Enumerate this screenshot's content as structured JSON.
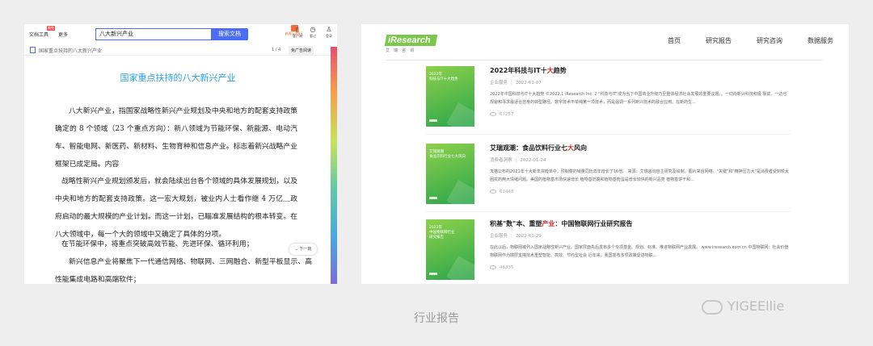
{
  "left": {
    "toolbar": {
      "doc_tools": "文档工具",
      "more": "更多",
      "badge": "限免",
      "search_value": "八大新兴产业",
      "search_button": "搜索文档",
      "gift_label": "新客立减8元",
      "icons": [
        {
          "name": "client-icon",
          "label": "客户端",
          "glyph": "▯"
        },
        {
          "name": "history-icon",
          "label": "看过",
          "glyph": "◷"
        },
        {
          "name": "user-icon",
          "label": "登录",
          "glyph": "♙"
        }
      ]
    },
    "docbar": {
      "title": "国家重点扶持的八大新兴产业",
      "page": "1 / 4",
      "read_button": "免广告阅读"
    },
    "document": {
      "title": "国家重点扶持的八大新兴产业",
      "p1": "八大新兴产业，指国家战略性新兴产业规划及中央和地方的配套支持政策确定的 8 个领域（23 个重点方向）：新八领域为节能环保、新能源、电动汽车、智能电网、新医药、新材料、生物育种和信息产业。标志着新兴战略产业框架已成定局。内容",
      "p2": "战略性新兴产业规划颁发后，就会陆续出台各个领域的具体发展规划，以及中央和地方的配套支持政策。这一宏大规划，被业内人士看作继 4 万亿＿政府启动的最大规模的产业计划。而这一计划，已瞄准发展结构的根本转变。在八大领域中，每一个大的领域中又确定了具体的分项。",
      "p3": "在节能环保中，将重点突破高效节能、先进环保、循环利用；",
      "p4": "新兴信息产业将聚焦下一代通信网络、物联网、三网融合、新型平板显示、高性能集成电路和高端软件；",
      "next_page": "下一篇"
    }
  },
  "right": {
    "logo": {
      "text": "iResearch",
      "sub": "艾瑞咨询"
    },
    "nav": [
      "首页",
      "研究报告",
      "研究咨询",
      "数据服务"
    ],
    "articles": [
      {
        "cover_text": "2022年\n科技与IT十大趋势",
        "title_pre": "2022年科技与IT十",
        "title_hl": "大",
        "title_post": "趋势",
        "category": "企业服务",
        "date": "2022-01-07",
        "summary": "2022年中国科技与IT十大趋势 ©2022.1 iResearch Inc. 2 \"科技与IT\"成为当下中国商业升级乃至整体经济社会发展的重要议题。。一切向新兴科技积极 靠拢、一边也规避和寻求最适合自身的转型路径。数字技术不单纯某一项技术，而是强调一系列新兴技术的融合应用。在新的生...",
        "views": "67257"
      },
      {
        "cover_text": "艾瑞观潮\n食品饮料行业七大风向",
        "title_pre": "艾瑞观潮：食品饮料行业七",
        "title_hl": "大",
        "title_post": "风向",
        "category": "消费者洞察",
        "date": "2022-01-24",
        "summary": "天猫公布的2021年十大新年货榜单中，预制菜的销量同比去年增长了16倍。 来源：艾瑞咨询自主研究及绘制。图片来自网络。\"关键\"和\"精神压力大\"是消费者受到较大困扰的两大情绪问题。美国的植物基市场快速增长 植物基奶酪和植物基肉蛋是增长较快的新兴品类 植物基饼干和...",
        "views": "61448"
      },
      {
        "cover_text": "2022年\n中国物联网行业\n研究报告",
        "title_pre": "积基\"数\"本、重塑",
        "title_hl": "产业",
        "title_post": "：中国物联网行业研究报告",
        "category": "企业服务",
        "date": "2022-01-29",
        "summary": "在此以后，物联网被列入国家战略性新兴产业。国家层面先后发布多个专项基金、规划、标准、推进物联网产业发展。 www.iresearch.com.cn 中国物联网：社会价值 物联网作为底层支撑技术重塑智能、高效、节约型社会 近年来，我国发布多项政策促进物联...",
        "views": "46335"
      }
    ]
  },
  "caption": "行业报告",
  "watermark": "YIGEEllie"
}
